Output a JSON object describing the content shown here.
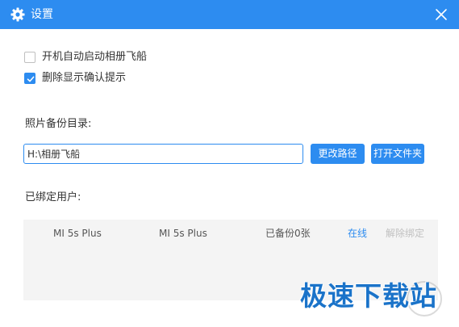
{
  "window": {
    "title": "设置",
    "titlebar_color": "#2d8cf0"
  },
  "icons": {
    "title": "gear-icon",
    "close": "close-icon",
    "check": "checkmark-icon"
  },
  "options": [
    {
      "label": "开机自动启动相册飞船",
      "checked": false
    },
    {
      "label": "删除显示确认提示",
      "checked": true
    }
  ],
  "backup": {
    "label": "照片备份目录:",
    "path_value": "H:\\相册飞船",
    "change_button": "更改路径",
    "open_button": "打开文件夹"
  },
  "users": {
    "label": "已绑定用户:",
    "rows": [
      {
        "device": "MI 5s Plus",
        "model": "MI 5s Plus",
        "backup_count": "已备份0张",
        "status": "在线",
        "action": "解除绑定"
      }
    ]
  },
  "watermark": {
    "text": "极速下载站"
  },
  "colors": {
    "accent": "#2d8cf0",
    "online": "#2d8cf0",
    "disabled_text": "#c0c0c0",
    "table_bg": "#f4f4f4"
  }
}
